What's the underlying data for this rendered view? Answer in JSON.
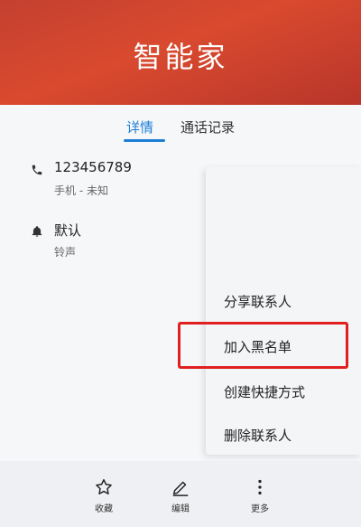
{
  "header": {
    "title": "智能家"
  },
  "tabs": [
    {
      "label": "详情",
      "active": true
    },
    {
      "label": "通话记录",
      "active": false
    }
  ],
  "phone": {
    "number": "123456789",
    "type": "手机 - 未知",
    "icon": "phone-icon",
    "message_icon": "message-icon"
  },
  "ringtone": {
    "value": "默认",
    "label": "铃声",
    "icon": "bell-icon",
    "chevron_icon": "chevron-right-icon"
  },
  "menu": {
    "items": [
      {
        "label": "分享联系人"
      },
      {
        "label": "加入黑名单",
        "highlighted": true
      },
      {
        "label": "创建快捷方式"
      },
      {
        "label": "删除联系人"
      }
    ]
  },
  "bottom_bar": {
    "items": [
      {
        "label": "收藏",
        "icon": "star-icon"
      },
      {
        "label": "编辑",
        "icon": "pencil-icon"
      },
      {
        "label": "更多",
        "icon": "more-vertical-icon"
      }
    ]
  },
  "colors": {
    "header": "#d04530",
    "accent": "#1b7fd6",
    "highlight": "#e02020"
  }
}
